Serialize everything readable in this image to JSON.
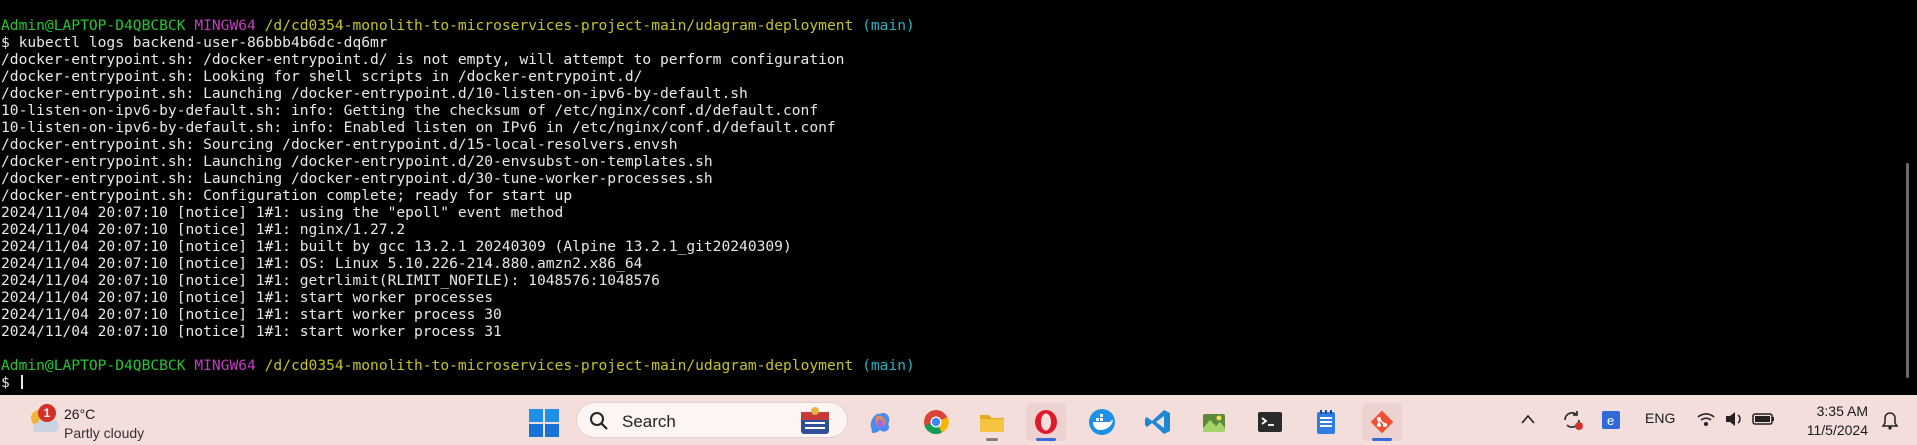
{
  "terminal": {
    "prompt1": {
      "user": "Admin@LAPTOP-D4QBCBCK",
      "system": "MINGW64",
      "path": "/d/cd0354-monolith-to-microservices-project-main/udagram-deployment",
      "branch": "(main)"
    },
    "command": "$ kubectl logs backend-user-86bbb4b6dc-dq6mr",
    "output": [
      "/docker-entrypoint.sh: /docker-entrypoint.d/ is not empty, will attempt to perform configuration",
      "/docker-entrypoint.sh: Looking for shell scripts in /docker-entrypoint.d/",
      "/docker-entrypoint.sh: Launching /docker-entrypoint.d/10-listen-on-ipv6-by-default.sh",
      "10-listen-on-ipv6-by-default.sh: info: Getting the checksum of /etc/nginx/conf.d/default.conf",
      "10-listen-on-ipv6-by-default.sh: info: Enabled listen on IPv6 in /etc/nginx/conf.d/default.conf",
      "/docker-entrypoint.sh: Sourcing /docker-entrypoint.d/15-local-resolvers.envsh",
      "/docker-entrypoint.sh: Launching /docker-entrypoint.d/20-envsubst-on-templates.sh",
      "/docker-entrypoint.sh: Launching /docker-entrypoint.d/30-tune-worker-processes.sh",
      "/docker-entrypoint.sh: Configuration complete; ready for start up",
      "2024/11/04 20:07:10 [notice] 1#1: using the \"epoll\" event method",
      "2024/11/04 20:07:10 [notice] 1#1: nginx/1.27.2",
      "2024/11/04 20:07:10 [notice] 1#1: built by gcc 13.2.1 20240309 (Alpine 13.2.1_git20240309)",
      "2024/11/04 20:07:10 [notice] 1#1: OS: Linux 5.10.226-214.880.amzn2.x86_64",
      "2024/11/04 20:07:10 [notice] 1#1: getrlimit(RLIMIT_NOFILE): 1048576:1048576",
      "2024/11/04 20:07:10 [notice] 1#1: start worker processes",
      "2024/11/04 20:07:10 [notice] 1#1: start worker process 30",
      "2024/11/04 20:07:10 [notice] 1#1: start worker process 31"
    ],
    "prompt2": {
      "user": "Admin@LAPTOP-D4QBCBCK",
      "system": "MINGW64",
      "path": "/d/cd0354-monolith-to-microservices-project-main/udagram-deployment",
      "branch": "(main)"
    },
    "input_prompt": "$ ",
    "colors": {
      "user": "#23c72f",
      "system": "#c53bc1",
      "path": "#c6c327",
      "branch": "#26b2c2",
      "text": "#e8e8e8",
      "background": "#000000"
    }
  },
  "taskbar": {
    "weather": {
      "badge": "1",
      "temperature": "26°C",
      "condition": "Partly cloudy",
      "icon": "partly-cloudy-icon"
    },
    "search": {
      "label": "Search"
    },
    "apps": [
      {
        "name": "copilot-icon",
        "active": false
      },
      {
        "name": "chrome-icon",
        "active": false
      },
      {
        "name": "file-explorer-icon",
        "active": false
      },
      {
        "name": "opera-icon",
        "active": true
      },
      {
        "name": "docker-icon",
        "active": false
      },
      {
        "name": "vscode-icon",
        "active": false
      },
      {
        "name": "image-viewer-icon",
        "active": false
      },
      {
        "name": "terminal-icon",
        "active": false
      },
      {
        "name": "notepad-icon",
        "active": false
      },
      {
        "name": "git-icon",
        "active": true
      }
    ],
    "tray": {
      "language": "ENG",
      "time": "3:35 AM",
      "date": "11/5/2024"
    },
    "colors": {
      "background": "#f3dedc",
      "accent": "#3a6ad6"
    }
  }
}
